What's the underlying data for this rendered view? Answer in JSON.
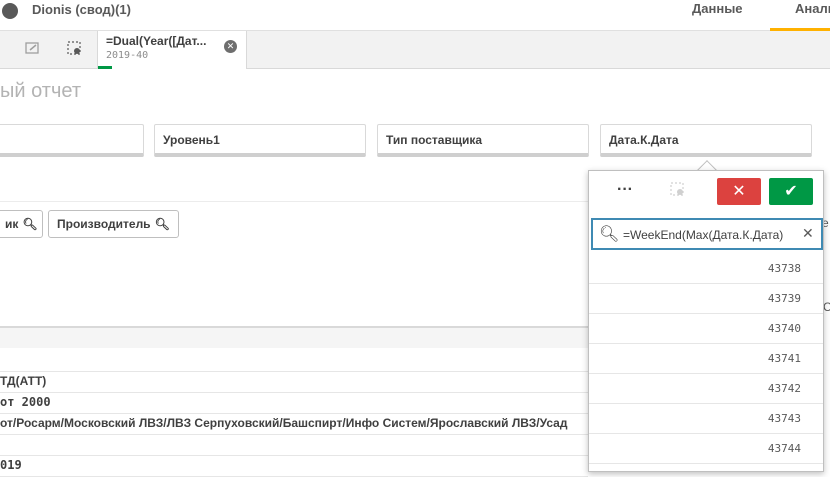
{
  "header": {
    "app_title": "Dionis (свод)(1)",
    "tabs": [
      {
        "label": "Данные"
      },
      {
        "label": "Анали"
      }
    ]
  },
  "toolbar": {
    "selection": {
      "field": "=Dual(Year([Дат...",
      "value": "2019-40"
    }
  },
  "sheet": {
    "title": "ый отчет"
  },
  "filters": [
    {
      "label": ""
    },
    {
      "label": "Уровень1"
    },
    {
      "label": "Тип поставщика"
    },
    {
      "label": "Дата.К.Дата"
    }
  ],
  "search_buttons": [
    {
      "label": "ик"
    },
    {
      "label": "Производитель"
    }
  ],
  "table": {
    "rows": [
      "ТД(АТТ)",
      "от 2000",
      "от/Росарм/Московский ЛВЗ/ЛВЗ Серпуховский/Башспирт/Инфо Систем/Ярославский ЛВЗ/Усад",
      "",
      "019"
    ]
  },
  "popup": {
    "more_label": "···",
    "search_value": "=WeekEnd(Max(Дата.К.Дата)",
    "values": [
      "43738",
      "43739",
      "43740",
      "43741",
      "43742",
      "43743",
      "43744"
    ]
  },
  "edge": {
    "e": "е",
    "c": "С"
  }
}
